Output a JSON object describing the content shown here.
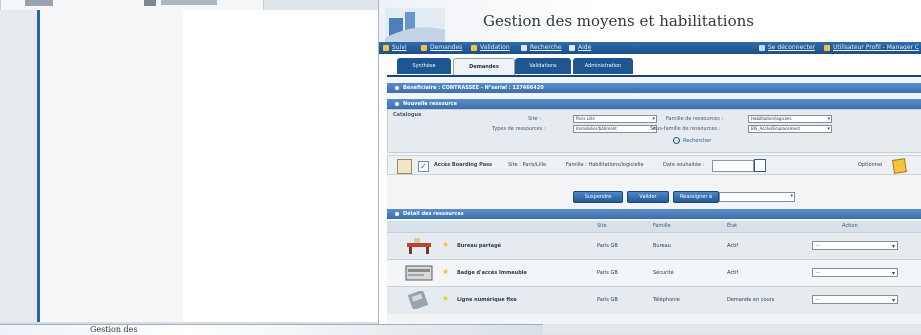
{
  "window": {
    "title": "Gestion des moyens et habilitations"
  },
  "nav": {
    "items": [
      {
        "label": "Suivi",
        "icon": "folder-icon"
      },
      {
        "label": "Demandes",
        "icon": "folder-icon"
      },
      {
        "label": "Validation",
        "icon": "folder-icon"
      },
      {
        "label": "Recherche",
        "icon": "search-icon"
      },
      {
        "label": "Aide",
        "icon": "help-icon"
      }
    ],
    "user_items": [
      {
        "label": "Se déconnecter",
        "icon": "user-icon"
      },
      {
        "label": "Utilisateur Profil - Manager C",
        "icon": "profile-icon"
      }
    ]
  },
  "tabs": [
    {
      "label": "Synthèse"
    },
    {
      "label": "Demandes",
      "active": true
    },
    {
      "label": "Validations"
    },
    {
      "label": "Administration"
    }
  ],
  "sections": {
    "beneficiary": "Bénéficiaire : CONTRASSEE - N°serial : 127466420",
    "new_resource": "Nouvelle ressource",
    "resource_detail": "Détail des ressources"
  },
  "catalogue": {
    "heading": "Catalogue",
    "site_label": "Site :",
    "site_value": "Paris Lille",
    "type_label": "Types de ressources :",
    "type_value": "Immobilier/bâtiment",
    "family_label": "Famille de ressources :",
    "family_value": "Habilitation/logiciels",
    "subfamily_label": "Sous-famille de ressources :",
    "subfamily_value": "BIS_Accès/Emplacement",
    "search_label": "Rechercher"
  },
  "result": {
    "name": "Accès Boarding Pass",
    "site": "Site : Paris/Lille",
    "family": "Famille : Habilitations/logicielle",
    "date_label": "Date souhaitée :",
    "comment_label": "Optionnel"
  },
  "buttons": {
    "suspend": "Suspendre",
    "validate": "Valider",
    "reassign": "Réassigner à"
  },
  "table": {
    "headers": [
      "Site",
      "Famille",
      "État",
      "Action"
    ],
    "rows": [
      {
        "name": "Bureau partagé",
        "site": "Paris GB",
        "family": "Bureau",
        "state": "Actif",
        "action": "--",
        "image": "desk-icon"
      },
      {
        "name": "Badge d'accès Immeuble",
        "site": "Paris GB",
        "family": "Sécurité",
        "state": "Actif",
        "action": "--",
        "image": "badge-icon"
      },
      {
        "name": "Ligne numérique fixe",
        "site": "Paris GB",
        "family": "Téléphonie",
        "state": "Demande en cours",
        "action": "--",
        "image": "phone-icon"
      }
    ]
  },
  "bottom_window": {
    "title": "Gestion des"
  },
  "colors": {
    "nav_bar": "#1d4f86",
    "section_head": "#3b6fab",
    "accent_star": "#f2c233"
  }
}
